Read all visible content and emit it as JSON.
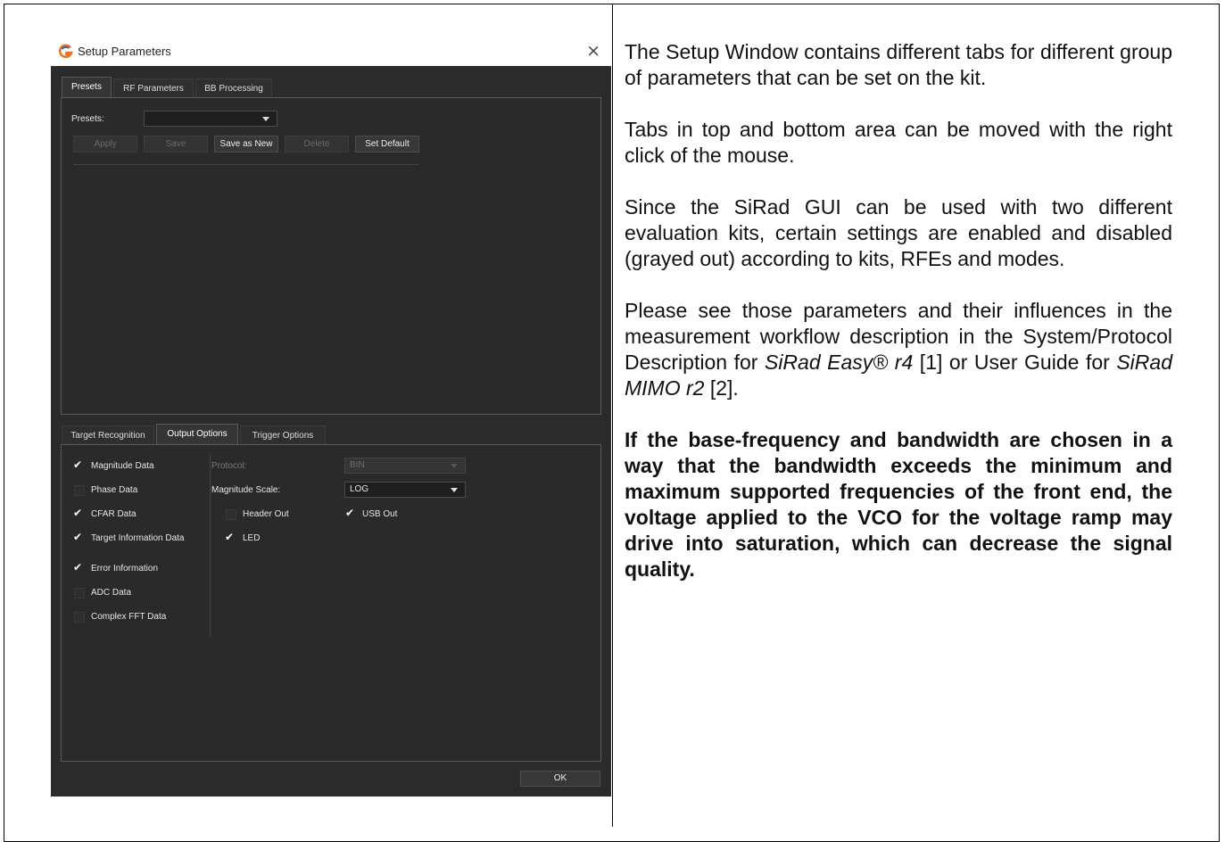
{
  "dialog": {
    "title": "Setup Parameters",
    "close_glyph": "×",
    "top_tabs": [
      "Presets",
      "RF Parameters",
      "BB Processing"
    ],
    "presets": {
      "label": "Presets:",
      "value": "",
      "buttons": {
        "apply": "Apply",
        "save": "Save",
        "save_as_new": "Save as New",
        "delete": "Delete",
        "set_default": "Set Default"
      }
    },
    "bottom_tabs": [
      "Target Recognition",
      "Output Options",
      "Trigger Options"
    ],
    "output_options": {
      "checkboxes": [
        {
          "label": "Magnitude Data",
          "checked": true
        },
        {
          "label": "Phase Data",
          "checked": false
        },
        {
          "label": "CFAR Data",
          "checked": true
        },
        {
          "label": "Target Information Data",
          "checked": true
        },
        {
          "label": "Error Information",
          "checked": true
        },
        {
          "label": "ADC Data",
          "checked": false
        },
        {
          "label": "Complex FFT Data",
          "checked": false
        }
      ],
      "protocol_label": "Protocol:",
      "protocol_value": "BIN",
      "magnitude_scale_label": "Magnitude Scale:",
      "magnitude_scale_value": "LOG",
      "header_out": {
        "label": "Header Out",
        "checked": false
      },
      "usb_out": {
        "label": "USB Out",
        "checked": true
      },
      "led": {
        "label": "LED",
        "checked": true
      }
    },
    "ok_label": "OK"
  },
  "text": {
    "p1": "The Setup Window contains different tabs for different group of parameters that can be set on the kit.",
    "p2": "Tabs in top and bottom area can be moved with the right click of the mouse.",
    "p3": "Since the SiRad GUI can be used with two different evaluation kits, certain settings are enabled and disabled (grayed out) according to kits, RFEs and modes.",
    "p4": {
      "a": "Please see those parameters and their influences in the measurement workflow description in the System/Protocol Description for ",
      "b": "SiRad Easy® r4",
      "c": " [1] or User Guide for ",
      "d": "SiRad MIMO r2",
      "e": " [2]."
    },
    "p5": "If the base-frequency and bandwidth are chosen in a way that the bandwidth exceeds the minimum and maximum supported frequencies of the front end, the voltage applied to the VCO for the voltage ramp may drive into saturation, which can decrease the signal quality."
  },
  "colors": {
    "dialog_bg": "#2b2b2b",
    "logo_orange": "#e8742a",
    "logo_blue": "#3a5fa8"
  },
  "icons": [
    "sirad-logo-icon",
    "close-icon",
    "chevron-down-icon",
    "checkmark-icon"
  ]
}
